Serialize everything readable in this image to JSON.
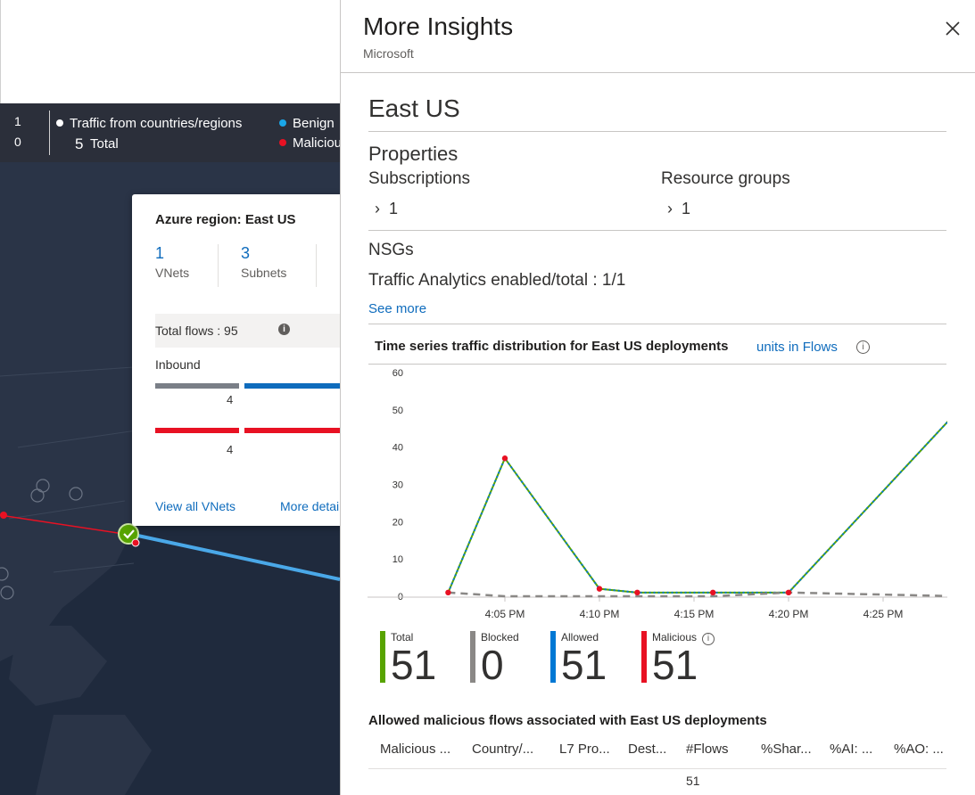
{
  "legend": {
    "count_top": "1",
    "count_bottom": "0",
    "traffic_label": "Traffic from countries/regions",
    "total_num": "5",
    "total_label": "Total",
    "benign": "Benign",
    "malicious": "Malicious",
    "benign_color": "#1aa7e8",
    "malicious_color": "#e81123"
  },
  "card": {
    "title": "Azure region: East US",
    "stats": [
      {
        "value": "1",
        "label": "VNets"
      },
      {
        "value": "3",
        "label": "Subnets"
      }
    ],
    "total_flows": "Total flows : 95",
    "inbound": "Inbound",
    "bar_values": [
      "4",
      "4"
    ],
    "link_vnets": "View all VNets",
    "link_details": "More details"
  },
  "panel": {
    "title": "More Insights",
    "subtitle": "Microsoft",
    "region": "East US",
    "properties_label": "Properties",
    "subscriptions_label": "Subscriptions",
    "subscriptions_value": "1",
    "resource_groups_label": "Resource groups",
    "resource_groups_value": "1",
    "nsgs_label": "NSGs",
    "ta_label": "Traffic Analytics enabled/total :",
    "ta_value": "1/1",
    "see_more": "See more",
    "ts_title": "Time series traffic distribution for East US deployments",
    "ts_units": "units in Flows"
  },
  "chart_data": {
    "type": "line",
    "x": [
      "4:02 PM",
      "4:05 PM",
      "4:10 PM",
      "4:12 PM",
      "4:16 PM",
      "4:20 PM",
      "4:29 PM"
    ],
    "xticks": [
      "4:05 PM",
      "4:10 PM",
      "4:15 PM",
      "4:20 PM",
      "4:25 PM"
    ],
    "yticks": [
      "60",
      "50",
      "40",
      "30",
      "20",
      "10",
      "0"
    ],
    "ylim": [
      0,
      60
    ],
    "series": [
      {
        "name": "Total",
        "color": "#57a300",
        "values": [
          1,
          37,
          2,
          1,
          1,
          1,
          50
        ]
      },
      {
        "name": "Allowed",
        "color": "#0078d4",
        "values": [
          1,
          37,
          2,
          1,
          1,
          1,
          50
        ]
      },
      {
        "name": "Malicious",
        "color": "#e81123",
        "values": [
          1,
          37,
          2,
          1,
          1,
          1,
          50
        ]
      },
      {
        "name": "Blocked",
        "color": "#8a8886",
        "values": [
          1,
          0,
          0,
          0,
          0,
          1,
          0
        ]
      }
    ]
  },
  "kpis": [
    {
      "label": "Total",
      "value": "51",
      "color": "#57a300"
    },
    {
      "label": "Blocked",
      "value": "0",
      "color": "#8a8886"
    },
    {
      "label": "Allowed",
      "value": "51",
      "color": "#0078d4"
    },
    {
      "label": "Malicious",
      "value": "51",
      "color": "#e81123"
    }
  ],
  "table": {
    "title": "Allowed malicious flows associated with East US deployments",
    "headers": [
      "Malicious ...",
      "Country/...",
      "L7 Pro...",
      "Dest...",
      "#Flows",
      "%Shar...",
      "%AI: ...",
      "%AO: ..."
    ],
    "row_flows": "51"
  }
}
